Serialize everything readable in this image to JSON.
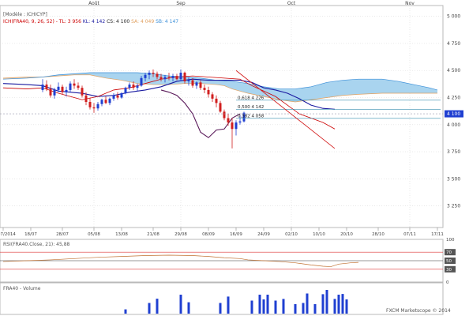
{
  "months": [
    "Août",
    "Sep",
    "Oct",
    "Nov"
  ],
  "header": {
    "template": "[Modèle : ICHICYP]",
    "legend": [
      {
        "text": "ICH(FRA40, 9, 26, 52) - ",
        "color": "#cc0000"
      },
      {
        "text": "TL: 3 956",
        "color": "#cc0000"
      },
      {
        "text": "KL: 4 142",
        "color": "#1a1aa0"
      },
      {
        "text": "CS: 4 100",
        "color": "#222222"
      },
      {
        "text": "SA: 4 049",
        "color": "#e0a060"
      },
      {
        "text": "SB: 4 147",
        "color": "#3b8fd8"
      }
    ]
  },
  "price_axis": {
    "ticks": [
      "5 000",
      "4 750",
      "4 500",
      "4 250",
      "4 000",
      "3 750",
      "3 500",
      "3 250"
    ],
    "current_price": "4 100"
  },
  "date_axis": [
    "09/07/2014",
    "18/07",
    "28/07",
    "05/08",
    "13/08",
    "21/08",
    "29/08",
    "08/09",
    "16/09",
    "24/09",
    "02/10",
    "10/10",
    "20/10",
    "28/10",
    "07/11",
    "17/11"
  ],
  "fibonacci": [
    {
      "label": "0,618  4 226",
      "value": 4226
    },
    {
      "label": "0,500  4 142",
      "value": 4142
    },
    {
      "label": "0,382  4 058",
      "value": 4058
    }
  ],
  "rsi": {
    "title": "RSI(FRA40.Close, 21): 45,88",
    "axis_labels": [
      "100",
      "70",
      "50",
      "30",
      "0"
    ]
  },
  "volume": {
    "title": "FRA40 - Volume"
  },
  "watermark": "FXCM Marketscope © 2014",
  "colors": {
    "bull": "#1f3fd1",
    "bear": "#d11f1f",
    "tenkan": "#cc0000",
    "kijun": "#1a1aa0",
    "chikou": "#5a1a5a",
    "senkou_a": "#e0a060",
    "senkou_b": "#3b8fd8",
    "cloud_bull": "#f6d3b2",
    "cloud_bear": "#a9d4ef",
    "trendline": "#d42020",
    "fib_line": "#3a8fb0",
    "volume": "#1f3fd1"
  },
  "chart_data": {
    "type": "candlestick",
    "instrument": "FRA40",
    "ylim": [
      3050,
      5100
    ],
    "ohlc_start_index": 10,
    "ohlc": [
      [
        4320,
        4420,
        4300,
        4370
      ],
      [
        4370,
        4410,
        4310,
        4330
      ],
      [
        4330,
        4370,
        4250,
        4270
      ],
      [
        4270,
        4340,
        4240,
        4320
      ],
      [
        4320,
        4390,
        4300,
        4350
      ],
      [
        4350,
        4370,
        4280,
        4300
      ],
      [
        4300,
        4350,
        4260,
        4320
      ],
      [
        4320,
        4400,
        4300,
        4380
      ],
      [
        4380,
        4420,
        4330,
        4360
      ],
      [
        4360,
        4390,
        4320,
        4340
      ],
      [
        4340,
        4360,
        4250,
        4270
      ],
      [
        4270,
        4300,
        4180,
        4210
      ],
      [
        4210,
        4250,
        4140,
        4160
      ],
      [
        4160,
        4200,
        4110,
        4150
      ],
      [
        4150,
        4210,
        4130,
        4190
      ],
      [
        4190,
        4240,
        4170,
        4230
      ],
      [
        4230,
        4260,
        4190,
        4200
      ],
      [
        4200,
        4250,
        4180,
        4240
      ],
      [
        4240,
        4290,
        4220,
        4270
      ],
      [
        4270,
        4300,
        4230,
        4250
      ],
      [
        4250,
        4300,
        4240,
        4290
      ],
      [
        4290,
        4350,
        4280,
        4340
      ],
      [
        4340,
        4390,
        4320,
        4370
      ],
      [
        4370,
        4400,
        4320,
        4340
      ],
      [
        4340,
        4380,
        4310,
        4360
      ],
      [
        4360,
        4450,
        4350,
        4430
      ],
      [
        4430,
        4480,
        4400,
        4460
      ],
      [
        4460,
        4500,
        4420,
        4480
      ],
      [
        4480,
        4510,
        4440,
        4470
      ],
      [
        4470,
        4490,
        4420,
        4440
      ],
      [
        4440,
        4470,
        4400,
        4420
      ],
      [
        4420,
        4460,
        4390,
        4440
      ],
      [
        4440,
        4480,
        4410,
        4430
      ],
      [
        4430,
        4470,
        4400,
        4450
      ],
      [
        4450,
        4470,
        4410,
        4420
      ],
      [
        4420,
        4510,
        4400,
        4480
      ],
      [
        4480,
        4490,
        4380,
        4400
      ],
      [
        4400,
        4440,
        4360,
        4410
      ],
      [
        4410,
        4430,
        4340,
        4360
      ],
      [
        4360,
        4400,
        4330,
        4390
      ],
      [
        4390,
        4410,
        4320,
        4340
      ],
      [
        4340,
        4370,
        4290,
        4320
      ],
      [
        4320,
        4350,
        4250,
        4280
      ],
      [
        4280,
        4300,
        4210,
        4240
      ],
      [
        4240,
        4270,
        4160,
        4200
      ],
      [
        4200,
        4220,
        4110,
        4120
      ],
      [
        4120,
        4140,
        4040,
        4060
      ],
      [
        4060,
        4100,
        3990,
        4020
      ],
      [
        4020,
        4060,
        3780,
        3960
      ],
      [
        3960,
        4040,
        3900,
        4020
      ],
      [
        4020,
        4090,
        4000,
        4030
      ],
      [
        4030,
        4120,
        4020,
        4110
      ]
    ],
    "tenkan": [
      [
        0,
        4340
      ],
      [
        6,
        4330
      ],
      [
        10,
        4340
      ],
      [
        14,
        4290
      ],
      [
        20,
        4230
      ],
      [
        24,
        4260
      ],
      [
        28,
        4320
      ],
      [
        32,
        4340
      ],
      [
        36,
        4380
      ],
      [
        40,
        4420
      ],
      [
        44,
        4440
      ],
      [
        48,
        4450
      ],
      [
        52,
        4440
      ],
      [
        56,
        4430
      ],
      [
        60,
        4420
      ],
      [
        63,
        4360
      ],
      [
        66,
        4310
      ],
      [
        69,
        4260
      ],
      [
        72,
        4180
      ],
      [
        75,
        4100
      ],
      [
        78,
        4060
      ],
      [
        81,
        4020
      ],
      [
        84,
        3960
      ]
    ],
    "kijun": [
      [
        0,
        4380
      ],
      [
        6,
        4370
      ],
      [
        10,
        4360
      ],
      [
        14,
        4310
      ],
      [
        20,
        4290
      ],
      [
        24,
        4260
      ],
      [
        28,
        4270
      ],
      [
        32,
        4300
      ],
      [
        36,
        4320
      ],
      [
        40,
        4350
      ],
      [
        44,
        4400
      ],
      [
        48,
        4420
      ],
      [
        52,
        4410
      ],
      [
        56,
        4410
      ],
      [
        60,
        4410
      ],
      [
        63,
        4390
      ],
      [
        66,
        4340
      ],
      [
        69,
        4320
      ],
      [
        72,
        4290
      ],
      [
        75,
        4240
      ],
      [
        78,
        4180
      ],
      [
        81,
        4150
      ],
      [
        84,
        4142
      ]
    ],
    "chikou": [
      [
        40,
        4320
      ],
      [
        42,
        4300
      ],
      [
        44,
        4270
      ],
      [
        46,
        4200
      ],
      [
        48,
        4100
      ],
      [
        50,
        3930
      ],
      [
        52,
        3880
      ],
      [
        54,
        3950
      ],
      [
        56,
        3960
      ],
      [
        58,
        4060
      ],
      [
        60,
        4100
      ]
    ],
    "senkou_a": [
      [
        0,
        4430
      ],
      [
        6,
        4440
      ],
      [
        10,
        4440
      ],
      [
        14,
        4450
      ],
      [
        18,
        4460
      ],
      [
        22,
        4460
      ],
      [
        26,
        4430
      ],
      [
        30,
        4410
      ],
      [
        34,
        4380
      ],
      [
        38,
        4370
      ],
      [
        42,
        4370
      ],
      [
        46,
        4380
      ],
      [
        50,
        4380
      ],
      [
        54,
        4370
      ],
      [
        56,
        4360
      ],
      [
        58,
        4330
      ],
      [
        62,
        4290
      ],
      [
        66,
        4260
      ],
      [
        70,
        4230
      ],
      [
        74,
        4210
      ],
      [
        78,
        4230
      ],
      [
        82,
        4250
      ],
      [
        86,
        4270
      ],
      [
        90,
        4280
      ],
      [
        96,
        4290
      ],
      [
        102,
        4290
      ],
      [
        108,
        4290
      ],
      [
        110,
        4290
      ]
    ],
    "senkou_b": [
      [
        0,
        4420
      ],
      [
        6,
        4430
      ],
      [
        10,
        4440
      ],
      [
        14,
        4460
      ],
      [
        18,
        4470
      ],
      [
        22,
        4480
      ],
      [
        26,
        4480
      ],
      [
        30,
        4480
      ],
      [
        34,
        4480
      ],
      [
        38,
        4470
      ],
      [
        42,
        4450
      ],
      [
        46,
        4440
      ],
      [
        50,
        4430
      ],
      [
        54,
        4410
      ],
      [
        58,
        4400
      ],
      [
        62,
        4380
      ],
      [
        66,
        4350
      ],
      [
        70,
        4330
      ],
      [
        74,
        4330
      ],
      [
        78,
        4350
      ],
      [
        82,
        4390
      ],
      [
        86,
        4410
      ],
      [
        90,
        4420
      ],
      [
        96,
        4420
      ],
      [
        100,
        4400
      ],
      [
        104,
        4370
      ],
      [
        108,
        4340
      ],
      [
        110,
        4320
      ]
    ],
    "trendline": [
      [
        59,
        4500
      ],
      [
        84,
        3780
      ]
    ],
    "rsi": [
      [
        0,
        48
      ],
      [
        6,
        50
      ],
      [
        12,
        52
      ],
      [
        18,
        55
      ],
      [
        24,
        58
      ],
      [
        30,
        60
      ],
      [
        36,
        62
      ],
      [
        42,
        63
      ],
      [
        48,
        62
      ],
      [
        52,
        60
      ],
      [
        56,
        57
      ],
      [
        60,
        55
      ],
      [
        62,
        52
      ],
      [
        66,
        50
      ],
      [
        70,
        48
      ],
      [
        74,
        45
      ],
      [
        78,
        40
      ],
      [
        81,
        37
      ],
      [
        83,
        36
      ],
      [
        85,
        42
      ],
      [
        88,
        45
      ],
      [
        90,
        46
      ]
    ],
    "volume": [
      [
        31,
        18
      ],
      [
        37,
        45
      ],
      [
        39,
        63
      ],
      [
        45,
        80
      ],
      [
        47,
        48
      ],
      [
        55,
        45
      ],
      [
        57,
        72
      ],
      [
        63,
        55
      ],
      [
        65,
        80
      ],
      [
        66,
        60
      ],
      [
        67,
        80
      ],
      [
        69,
        55
      ],
      [
        71,
        62
      ],
      [
        74,
        40
      ],
      [
        76,
        45
      ],
      [
        77,
        85
      ],
      [
        79,
        40
      ],
      [
        81,
        82
      ],
      [
        82,
        100
      ],
      [
        84,
        62
      ],
      [
        85,
        80
      ],
      [
        86,
        83
      ],
      [
        87,
        60
      ]
    ]
  }
}
